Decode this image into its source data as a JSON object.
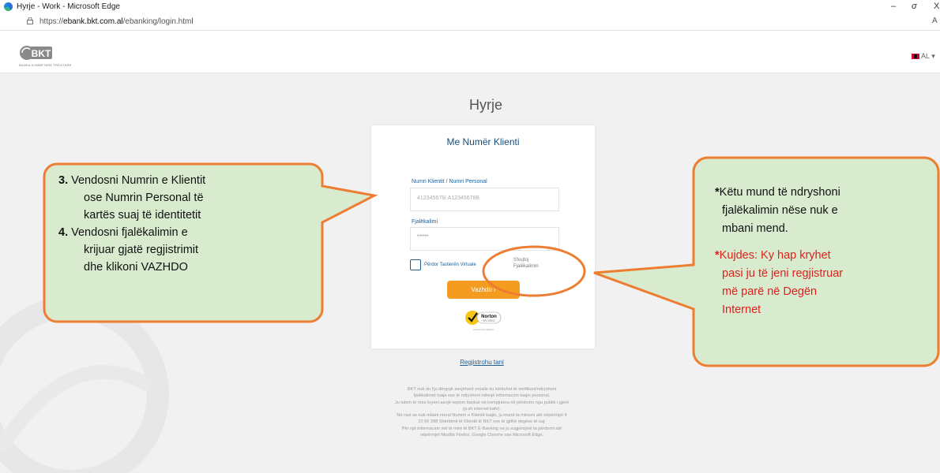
{
  "window": {
    "title": "Hyrje - Work - Microsoft Edge",
    "minimize": "–",
    "restore": "☐",
    "close": "X"
  },
  "address_bar": {
    "url_prefix": "https://",
    "url_host": "ebank.bkt.com.al",
    "url_path": "/ebanking/login.html",
    "read_aloud": "A"
  },
  "header": {
    "logo_text": "BKT",
    "logo_subtitle": "BANKA KOMBËTARE TREGTARE",
    "language": "AL",
    "language_caret": "▾"
  },
  "main": {
    "page_title": "Hyrje",
    "card_title": "Me Numër Klienti",
    "client_label": "Numri Klientit / Numri Personal",
    "client_placeholder": "412345678/ A12345678B",
    "password_label": "Fjalëkalimi",
    "password_placeholder": "••••••",
    "virtual_keyboard_label": "Përdor Tastierën Virtuale",
    "forgot_line1": "S'kujtoj",
    "forgot_line2": "Fjalëkalimin",
    "continue_button": "Vazhdo ›",
    "norton_text": "Norton",
    "norton_secured": "SECURED",
    "norton_powered": "powered by digicert",
    "register_link": "Regjistrohu tani",
    "footer_lines": [
      "BKT nuk do t'ju dërgojë asnjëherë emaile ku kërkohet të verifikoni/ndryshoni",
      "fjalëkalimet tuaja ose të ndryshoni ndonjë informacion tuajin personal.",
      "Ju lutem të mos kryeni asnjë veprim bankar në kompjutera në përdorim nga publik i gjerë",
      "(p.sh internet kafe).",
      "Në rast se nuk mbani mend Numrin e Klientit tuajin, ju mund ta mësoni atë nëpërmjet 4",
      "22 66 288 Shërbimit të Klientit të BKT ose të gjithë degëve të saj.",
      "Për një informacion më të mirë të BKT E-Banking ne ju sugjerojmë ta përdorni atë",
      "nëpërmjet Mozilla Firefox, Google Chrome ose Microsoft Edge."
    ]
  },
  "callout_left": {
    "step3_num": "3.",
    "step3_line1": "Vendosni Numrin e Klientit",
    "step3_line2": "ose Numrin Personal të",
    "step3_line3": "kartës suaj të identitetit",
    "step4_num": "4.",
    "step4_line1": "Vendosni fjalëkalimin e",
    "step4_line2": "krijuar gjatë regjistrimit",
    "step4_line3": "dhe klikoni VAZHDO"
  },
  "callout_right": {
    "note1_star": "*",
    "note1_line1": "Këtu mund të ndryshoni",
    "note1_line2": "fjalëkalimin nëse nuk e",
    "note1_line3": "mbani mend.",
    "note2_star": "*",
    "note2_line1": "Kujdes: Ky hap kryhet",
    "note2_line2": "pasi ju të jeni regjistruar",
    "note2_line3": "më parë në Degën",
    "note2_line4": "Internet"
  },
  "colors": {
    "accent_orange": "#f39c1f",
    "callout_fill": "#d9ebcf",
    "callout_border": "#ed7d31",
    "link_blue": "#1e5f99",
    "warning_red": "#e0201b"
  }
}
